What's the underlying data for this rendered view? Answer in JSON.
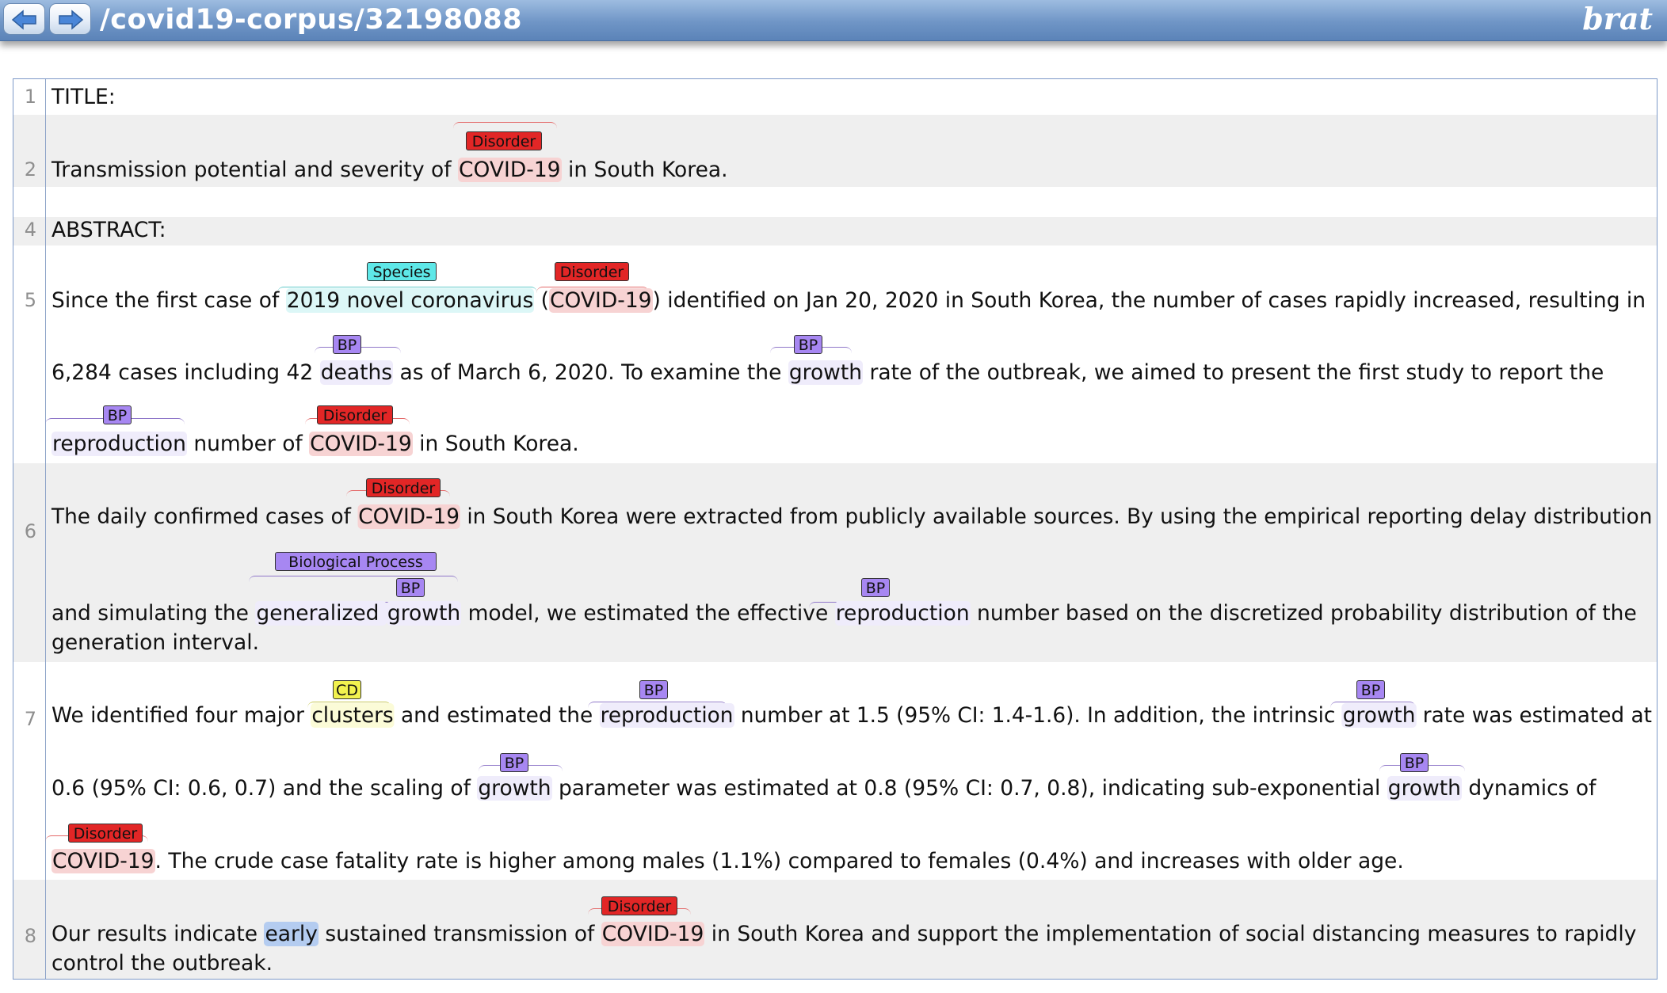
{
  "header": {
    "back_icon": "left-arrow-icon",
    "forward_icon": "right-arrow-icon",
    "path": "/covid19-corpus/32198088",
    "logo": "brat"
  },
  "colors": {
    "Disorder": "#e22626",
    "BP": "#a787f2",
    "Species": "#5ee8e8",
    "CD": "#f2f24f",
    "selection": "#b4ccf0"
  },
  "document": {
    "line_numbers": [
      "1",
      "2",
      "4",
      "5",
      "6",
      "7",
      "8"
    ],
    "l1": "TITLE:",
    "l2": {
      "a": "Transmission potential and severity of ",
      "e1": "COVID-19",
      "b": " in South Korea.",
      "lbl1": "Disorder"
    },
    "l4": "ABSTRACT:",
    "l5a": {
      "a": "Since the first case of ",
      "e1": "2019 novel coronavirus",
      "b": " (",
      "e2": "COVID-19",
      "c": ") identified on Jan 20, 2020 in South Korea, the number of cases rapidly increased, resulting in",
      "lbl1": "Species",
      "lbl2": "Disorder"
    },
    "l5b": {
      "a": "6,284 cases including 42 ",
      "e1": "deaths",
      "b": " as of March 6, 2020. To examine the ",
      "e2": "growth",
      "c": " rate of the outbreak, we aimed to present the first study to report the",
      "lbl1": "BP",
      "lbl2": "BP"
    },
    "l5c": {
      "e1": "reproduction",
      "a": " number of ",
      "e2": "COVID-19",
      "b": " in South Korea.",
      "lbl1": "BP",
      "lbl2": "Disorder"
    },
    "l6a": {
      "a": "The daily confirmed cases of ",
      "e1": "COVID-19",
      "b": " in South Korea were extracted from publicly available sources. By using the empirical reporting delay distribution",
      "lbl1": "Disorder"
    },
    "l6b": {
      "a": "and simulating the ",
      "e1": "generalized ",
      "e2": "growth",
      "b": " model, we estimated the effective ",
      "e3": "reproduction",
      "c": " number based on the discretized probability distribution of the",
      "lbl1": "Biological Process",
      "lbl2": "BP",
      "lbl3": "BP"
    },
    "l6c": "generation interval.",
    "l7a": {
      "a": "We identified four major ",
      "e1": "clusters",
      "b": " and estimated the ",
      "e2": "reproduction",
      "c": " number at 1.5 (95% CI: 1.4-1.6). In addition, the intrinsic ",
      "e3": "growth",
      "d": " rate was estimated at",
      "lbl1": "CD",
      "lbl2": "BP",
      "lbl3": "BP"
    },
    "l7b": {
      "a": "0.6 (95% CI: 0.6, 0.7) and the scaling of ",
      "e1": "growth",
      "b": " parameter was estimated at 0.8 (95% CI: 0.7, 0.8), indicating sub-exponential ",
      "e2": "growth",
      "c": " dynamics of",
      "lbl1": "BP",
      "lbl2": "BP"
    },
    "l7c": {
      "e1": "COVID-19",
      "a": ". The crude case fatality rate is higher among males (1.1%) compared to females (0.4%) and increases with older age.",
      "lbl1": "Disorder"
    },
    "l8a": {
      "a": "Our results indicate ",
      "e0": "early",
      "b": " sustained transmission of ",
      "e1": "COVID-19",
      "c": " in South Korea and support the implementation of social distancing measures to rapidly",
      "lbl1": "Disorder"
    },
    "l8b": "control the outbreak."
  }
}
